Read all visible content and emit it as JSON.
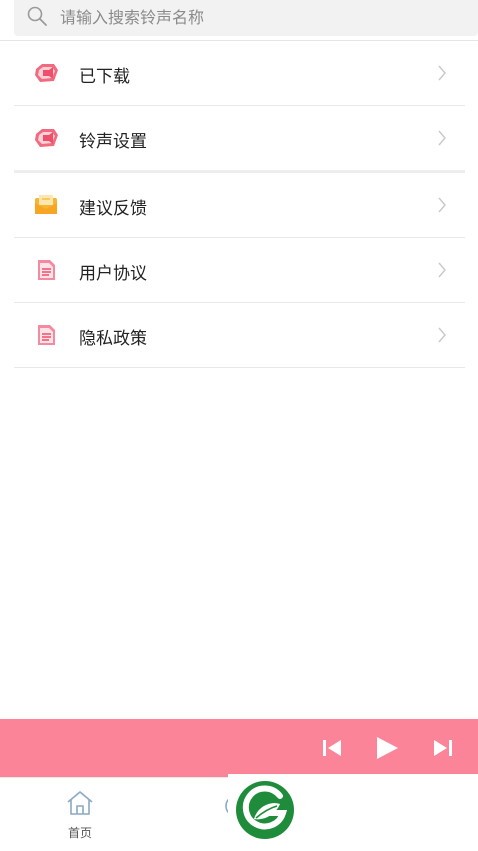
{
  "search": {
    "placeholder": "请输入搜索铃声名称"
  },
  "menu": {
    "items": [
      {
        "label": "已下载",
        "icon": "ringtone-icon"
      },
      {
        "label": "铃声设置",
        "icon": "ringtone-icon"
      },
      {
        "label": "建议反馈",
        "icon": "envelope-icon"
      },
      {
        "label": "用户协议",
        "icon": "document-icon"
      },
      {
        "label": "隐私政策",
        "icon": "document-icon"
      }
    ]
  },
  "player": {
    "background": "#fc8499"
  },
  "tabbar": {
    "home_label": "首页"
  },
  "colors": {
    "accent_pink": "#fc8499",
    "icon_pink": "#ef4f6a",
    "icon_yellow": "#f8b534",
    "logo_green": "#1e8c3a"
  }
}
